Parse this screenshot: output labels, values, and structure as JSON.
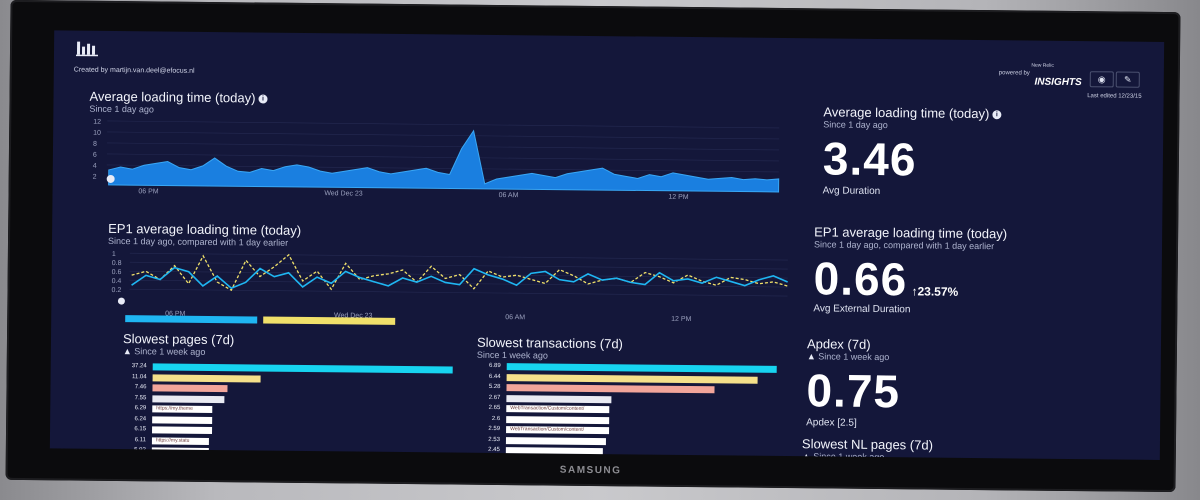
{
  "header": {
    "creator": "Created by martijn.van.deel@efocus.nl",
    "new_relic": "New Relic",
    "powered_by": "powered by",
    "insights": "INSIGHTS",
    "last_edited": "Last edited 12/23/15",
    "button_a_icon": "lightbulb-icon",
    "button_b_icon": "wrench-icon"
  },
  "panel1": {
    "title": "Average loading time (today)",
    "subtitle": "Since 1 day ago",
    "y_ticks": [
      "12",
      "10",
      "8",
      "6",
      "4",
      "2"
    ],
    "x_ticks": [
      "06 PM",
      "Wed Dec 23",
      "06 AM",
      "12 PM"
    ],
    "series_color": "#1a9bf0"
  },
  "panel2": {
    "title": "EP1 average loading time (today)",
    "subtitle": "Since 1 day ago, compared with 1 day earlier",
    "y_ticks": [
      "1",
      "0.8",
      "0.6",
      "0.4",
      "0.2"
    ],
    "x_ticks": [
      "06 PM",
      "Wed Dec 23",
      "06 AM",
      "12 PM"
    ],
    "current_color": "#1fb6f2",
    "previous_color": "#f0e06a"
  },
  "metric1": {
    "title": "Average loading time (today)",
    "subtitle": "Since 1 day ago",
    "value": "3.46",
    "label": "Avg Duration"
  },
  "metric2": {
    "title": "EP1 average loading time (today)",
    "subtitle": "Since 1 day ago, compared with 1 day earlier",
    "value": "0.66",
    "delta": "23.57%",
    "label": "Avg External Duration"
  },
  "metric3": {
    "title": "Apdex (7d)",
    "subtitle": "Since 1 week ago",
    "value": "0.75",
    "label": "Apdex [2.5]"
  },
  "slowest_nl": {
    "title": "Slowest NL pages (7d)",
    "subtitle": "Since 1 week ago"
  },
  "slowest_pages": {
    "title": "Slowest pages (7d)",
    "subtitle": "Since 1 week ago",
    "rows": [
      {
        "value": "37.24",
        "fraction": 1.0,
        "color": "#17d4f0"
      },
      {
        "value": "11.04",
        "fraction": 0.36,
        "color": "#f5e08a"
      },
      {
        "value": "7.46",
        "fraction": 0.25,
        "color": "#f2a59a"
      },
      {
        "value": "7.55",
        "fraction": 0.24,
        "color": "#e9eaf2"
      },
      {
        "value": "6.29",
        "fraction": 0.2,
        "color": "#ffffff",
        "inner": "https://my.theme"
      },
      {
        "value": "6.24",
        "fraction": 0.2,
        "color": "#ffffff"
      },
      {
        "value": "6.15",
        "fraction": 0.2,
        "color": "#ffffff"
      },
      {
        "value": "6.11",
        "fraction": 0.19,
        "color": "#ffffff",
        "inner": "https://my.statu"
      },
      {
        "value": "5.92",
        "fraction": 0.19,
        "color": "#ffffff"
      }
    ]
  },
  "slowest_transactions": {
    "title": "Slowest transactions (7d)",
    "subtitle": "Since 1 week ago",
    "rows": [
      {
        "value": "6.89",
        "fraction": 1.0,
        "color": "#17d4f0"
      },
      {
        "value": "6.44",
        "fraction": 0.93,
        "color": "#f5e08a"
      },
      {
        "value": "5.28",
        "fraction": 0.77,
        "color": "#f2a59a"
      },
      {
        "value": "2.67",
        "fraction": 0.39,
        "color": "#e9eaf2"
      },
      {
        "value": "2.65",
        "fraction": 0.38,
        "color": "#ffffff",
        "inner": "WebTransaction/Custom/content/"
      },
      {
        "value": "2.6",
        "fraction": 0.38,
        "color": "#ffffff"
      },
      {
        "value": "2.59",
        "fraction": 0.38,
        "color": "#ffffff",
        "inner": "WebTransaction/Custom/content/"
      },
      {
        "value": "2.53",
        "fraction": 0.37,
        "color": "#ffffff"
      },
      {
        "value": "2.45",
        "fraction": 0.36,
        "color": "#ffffff"
      }
    ]
  },
  "monitor_brand": "SAMSUNG"
}
